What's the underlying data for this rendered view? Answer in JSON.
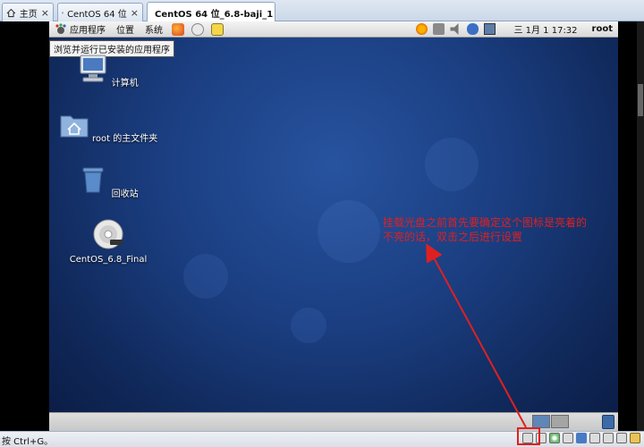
{
  "tabs": [
    {
      "label": "主页",
      "icon": "home-icon"
    },
    {
      "label": "CentOS 64 位",
      "icon": "vm-icon"
    },
    {
      "label": "CentOS 64 位_6.8-baji_1",
      "icon": "vm-icon",
      "active": true
    }
  ],
  "gnome_panel": {
    "menus": [
      "应用程序",
      "位置",
      "系统"
    ],
    "launchers": [
      "firefox-icon",
      "mail-icon",
      "notes-icon"
    ],
    "tray": [
      "update-icon",
      "network-icon",
      "volume-icon",
      "bluetooth-icon",
      "display-icon"
    ],
    "clock": "三 1月  1 17:32",
    "user": "root"
  },
  "tooltip": "浏览并运行已安装的应用程序",
  "desktop_icons": [
    {
      "label": "计算机",
      "icon": "computer-icon"
    },
    {
      "label": "root 的主文件夹",
      "icon": "home-folder-icon"
    },
    {
      "label": "回收站",
      "icon": "trash-icon"
    },
    {
      "label": "CentOS_6.8_Final",
      "icon": "dvd-icon"
    }
  ],
  "annotation": {
    "line1": "挂载光盘之前首先要确定这个图标是亮着的",
    "line2": "不亮的话，双击之后进行设置",
    "color": "#e02020"
  },
  "status": {
    "hint": "按 Ctrl+G。"
  },
  "colors": {
    "desktop_bg": "#1a3d7f",
    "tab_bar": "#cbd8e8",
    "highlight": "#e02020"
  }
}
